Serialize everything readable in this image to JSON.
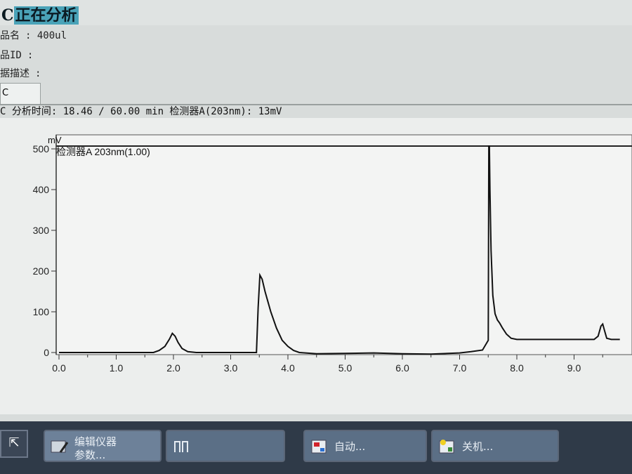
{
  "window": {
    "title_prefix": "C",
    "title": "正在分析"
  },
  "info": {
    "sample_name_label": "品名",
    "sample_name_value": ": 400ul",
    "sample_id_label": "品ID",
    "sample_id_value": ":",
    "data_desc_label": "据描述",
    "data_desc_value": ":"
  },
  "tab": {
    "label": "C"
  },
  "status": {
    "text": "C 分析时间: 18.46 / 60.00 min 检测器A(203nm): 13mV"
  },
  "chart_data": {
    "type": "line",
    "ylabel": "mV",
    "series_label": "检测器A 203nm(1.00)",
    "xlim": [
      0.0,
      9.8
    ],
    "ylim": [
      -30,
      520
    ],
    "xticks": [
      "0.0",
      "1.0",
      "2.0",
      "3.0",
      "4.0",
      "5.0",
      "6.0",
      "7.0",
      "8.0",
      "9.0"
    ],
    "yticks": [
      "0",
      "100",
      "200",
      "300",
      "400",
      "500"
    ],
    "grid": true,
    "series": [
      {
        "x": [
          0.0,
          0.5,
          1.0,
          1.5,
          1.65,
          1.75,
          1.85,
          1.93,
          1.98,
          2.03,
          2.08,
          2.15,
          2.25,
          2.4,
          2.8,
          3.2,
          3.45,
          3.48,
          3.51,
          3.55,
          3.6,
          3.7,
          3.8,
          3.9,
          4.0,
          4.1,
          4.2,
          4.5,
          5.0,
          5.5,
          6.0,
          6.5,
          7.0,
          7.2,
          7.4,
          7.5,
          7.51,
          7.52,
          7.53,
          7.55,
          7.58,
          7.62,
          7.66,
          7.7,
          7.75,
          7.82,
          7.9,
          8.0,
          8.5,
          9.0,
          9.35,
          9.42,
          9.47,
          9.5,
          9.53,
          9.57,
          9.65,
          9.8
        ],
        "y": [
          0,
          0,
          0,
          0,
          0,
          5,
          15,
          33,
          47,
          40,
          25,
          10,
          2,
          0,
          0,
          0,
          0,
          110,
          190,
          180,
          150,
          100,
          60,
          30,
          15,
          5,
          0,
          -3,
          -2,
          -1,
          -3,
          -4,
          -1,
          2,
          6,
          30,
          520,
          520,
          400,
          250,
          140,
          95,
          80,
          72,
          60,
          45,
          35,
          32,
          32,
          32,
          32,
          40,
          65,
          70,
          55,
          35,
          32,
          32
        ]
      }
    ]
  },
  "taskbar": {
    "start_glyph": "⇱",
    "buttons": [
      {
        "label_line1": "编辑仪器",
        "label_line2": "参数..."
      },
      {
        "label_line1": "",
        "label_line2": ""
      },
      {
        "label_line1": "自动...",
        "label_line2": ""
      },
      {
        "label_line1": "关机...",
        "label_line2": ""
      }
    ]
  }
}
